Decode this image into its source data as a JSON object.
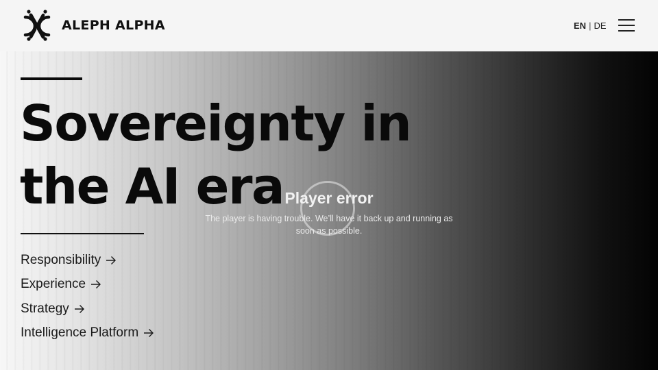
{
  "header": {
    "brand": "ALEPH ALPHA",
    "lang_en": "EN",
    "lang_sep": "|",
    "lang_de": "DE",
    "logo_icon": "aleph-alpha-logo-icon",
    "menu_icon": "hamburger-menu-icon"
  },
  "hero": {
    "headline_line1": "Sovereignty in",
    "headline_line2": "the AI era",
    "links": [
      {
        "label": "Responsibility",
        "icon": "arrow-right-icon"
      },
      {
        "label": "Experience",
        "icon": "arrow-right-icon"
      },
      {
        "label": "Strategy",
        "icon": "arrow-right-icon"
      },
      {
        "label": "Intelligence Platform",
        "icon": "arrow-right-icon"
      }
    ]
  },
  "player": {
    "title": "Player error",
    "message": "The player is having trouble. We’ll have it back up and running as soon as possible.",
    "spinner_icon": "loading-spinner-icon"
  },
  "colors": {
    "header_bg": "#f5f5f5",
    "text_dark": "#0a0a0a",
    "gradient_start": "#f7f7f7",
    "gradient_end": "#030303",
    "player_text": "#f2f2f2"
  }
}
